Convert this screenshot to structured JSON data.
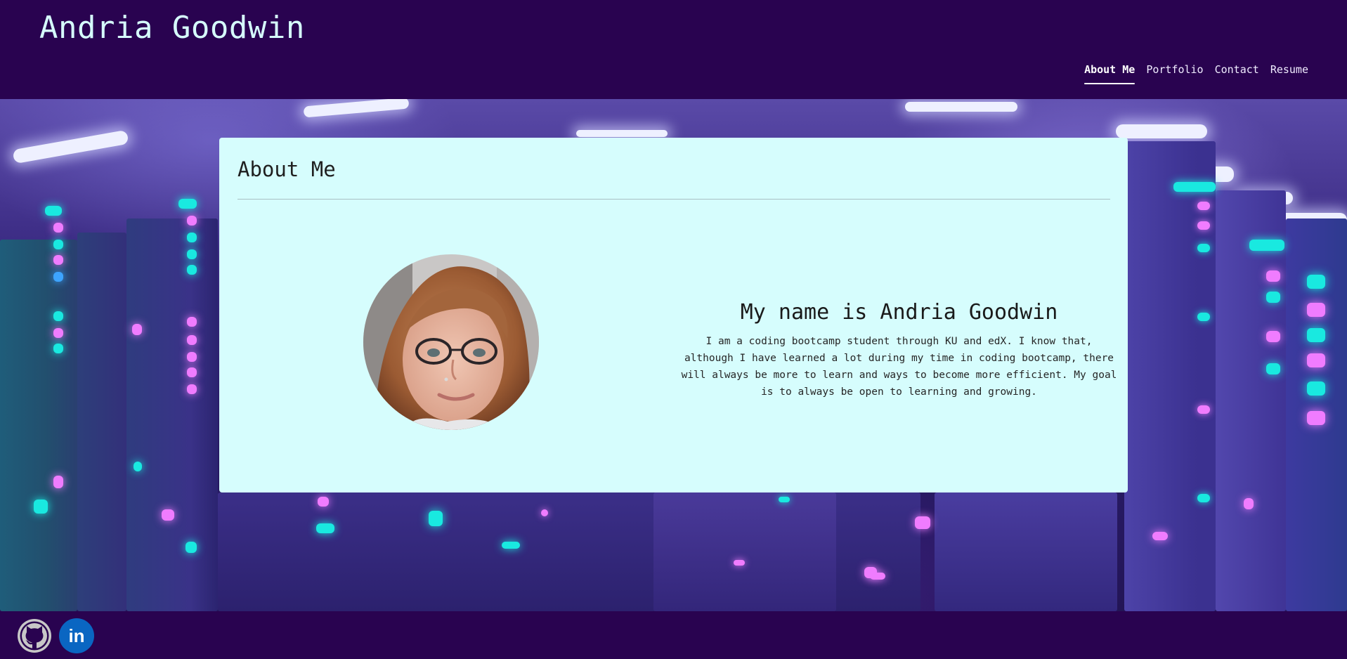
{
  "header": {
    "site_title": "Andria Goodwin",
    "nav": [
      {
        "label": "About Me",
        "active": true
      },
      {
        "label": "Portfolio",
        "active": false
      },
      {
        "label": "Contact",
        "active": false
      },
      {
        "label": "Resume",
        "active": false
      }
    ]
  },
  "about": {
    "section_title": "About Me",
    "heading": "My name is Andria Goodwin",
    "paragraph": "I am a coding bootcamp student through KU and edX. I know that, although I have learned a lot during my time in coding bootcamp, there will always be more to learn and ways to become more efficient. My goal is to always be open to learning and growing."
  },
  "footer": {
    "social": [
      {
        "icon": "github-icon"
      },
      {
        "icon": "linkedin-icon",
        "text": "in"
      }
    ]
  },
  "colors": {
    "header_bg": "#290350",
    "title_text": "#d6fdfd",
    "card_bg": "#d6fdfd",
    "linkedin": "#0a66c2",
    "github": "#c7c7c7"
  }
}
